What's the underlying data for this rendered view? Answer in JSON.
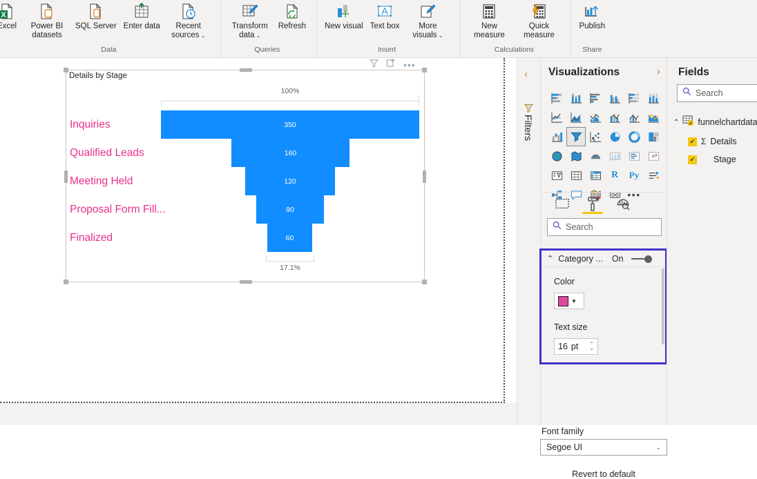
{
  "ribbon": {
    "groups": [
      {
        "label": "Data",
        "items": [
          {
            "name": "excel",
            "label": "Excel",
            "icon": "excel-icon",
            "chevron": false
          },
          {
            "name": "power-bi-datasets",
            "label": "Power BI datasets",
            "icon": "dataset-icon",
            "chevron": false
          },
          {
            "name": "sql-server",
            "label": "SQL Server",
            "icon": "sql-server-icon",
            "chevron": false
          },
          {
            "name": "enter-data",
            "label": "Enter data",
            "icon": "enter-data-icon",
            "chevron": false
          },
          {
            "name": "recent-sources",
            "label": "Recent sources",
            "icon": "recent-sources-icon",
            "chevron": true
          }
        ]
      },
      {
        "label": "Queries",
        "items": [
          {
            "name": "transform-data",
            "label": "Transform data",
            "icon": "transform-data-icon",
            "chevron": true
          },
          {
            "name": "refresh",
            "label": "Refresh",
            "icon": "refresh-icon",
            "chevron": false
          }
        ]
      },
      {
        "label": "Insert",
        "items": [
          {
            "name": "new-visual",
            "label": "New visual",
            "icon": "new-visual-icon",
            "chevron": false
          },
          {
            "name": "text-box",
            "label": "Text box",
            "icon": "text-box-icon",
            "chevron": false
          },
          {
            "name": "more-visuals",
            "label": "More visuals",
            "icon": "more-visuals-icon",
            "chevron": true
          }
        ]
      },
      {
        "label": "Calculations",
        "items": [
          {
            "name": "new-measure",
            "label": "New measure",
            "icon": "new-measure-icon",
            "chevron": false
          },
          {
            "name": "quick-measure",
            "label": "Quick measure",
            "icon": "quick-measure-icon",
            "chevron": false
          }
        ]
      },
      {
        "label": "Share",
        "items": [
          {
            "name": "publish",
            "label": "Publish",
            "icon": "publish-icon",
            "chevron": false
          }
        ]
      }
    ]
  },
  "visual": {
    "title": "Details by Stage",
    "header_icons": [
      "filter-icon",
      "focus-mode-icon",
      "more-options-icon"
    ],
    "axis_top_label": "100%",
    "axis_bottom_label": "17.1%"
  },
  "chart_data": {
    "type": "bar",
    "chart_subtype": "funnel",
    "title": "Details by Stage",
    "categories": [
      "Inquiries",
      "Qualified Leads",
      "Meeting Held",
      "Proposal Form Fill...",
      "Finalized"
    ],
    "values": [
      350,
      160,
      120,
      90,
      60
    ],
    "data_labels": [
      "350",
      "160",
      "120",
      "90",
      "60"
    ],
    "xlabel": "",
    "ylabel": "",
    "top_percent": "100%",
    "conversion_rate": "17.1%",
    "bar_color": "#118DFF",
    "category_label_color": "#E8308A",
    "data_label_color": "#FFFFFF",
    "grid": false,
    "legend": "none"
  },
  "filters_rail": {
    "collapse_label": "‹",
    "title": "Filters",
    "icon": "filter-icon"
  },
  "visualizations": {
    "title": "Visualizations",
    "expand_label": "›",
    "icons": [
      "stacked-bar-chart-icon",
      "stacked-column-chart-icon",
      "clustered-bar-chart-icon",
      "clustered-column-chart-icon",
      "100-stacked-bar-chart-icon",
      "100-stacked-column-chart-icon",
      "line-chart-icon",
      "area-chart-icon",
      "stacked-area-chart-icon",
      "line-and-stacked-column-chart-icon",
      "line-and-clustered-column-chart-icon",
      "ribbon-chart-icon",
      "waterfall-chart-icon",
      "funnel-chart-icon",
      "scatter-chart-icon",
      "pie-chart-icon",
      "donut-chart-icon",
      "treemap-icon",
      "map-icon",
      "filled-map-icon",
      "arcgis-map-icon",
      "card-icon",
      "multi-row-card-icon",
      "kpi-icon",
      "slicer-icon",
      "table-icon",
      "matrix-icon",
      "r-script-visual-icon",
      "python-visual-icon",
      "key-influencers-icon",
      "decomposition-tree-icon",
      "q-and-a-icon",
      "paginated-report-icon",
      "smart-narrative-icon",
      "more-visuals-icon"
    ],
    "selected_icon": "funnel-chart-icon",
    "selected_index": 13,
    "tabs": [
      {
        "name": "fields-tab",
        "icon": "fields-pane-icon",
        "active": false
      },
      {
        "name": "format-tab",
        "icon": "paint-roller-icon",
        "active": true
      },
      {
        "name": "analytics-tab",
        "icon": "analytics-magnifier-icon",
        "active": false
      }
    ],
    "search_placeholder": "Search"
  },
  "format_pane": {
    "category_card": {
      "name": "Category ...",
      "toggle_state": "On",
      "color_label": "Color",
      "color_value": "#E0469E",
      "text_size_label": "Text size",
      "text_size_value": "16",
      "text_size_unit": "pt"
    },
    "font_family_label": "Font family",
    "font_family_value": "Segoe UI",
    "revert_label": "Revert to default",
    "highlight_color": "#3F34C9"
  },
  "fields": {
    "title": "Fields",
    "search_placeholder": "Search",
    "table": {
      "name": "funnelchartdata",
      "expanded": true,
      "columns": [
        {
          "name": "Details",
          "aggregate": "Σ",
          "checked": true
        },
        {
          "name": "Stage",
          "aggregate": "",
          "checked": true
        }
      ]
    }
  }
}
